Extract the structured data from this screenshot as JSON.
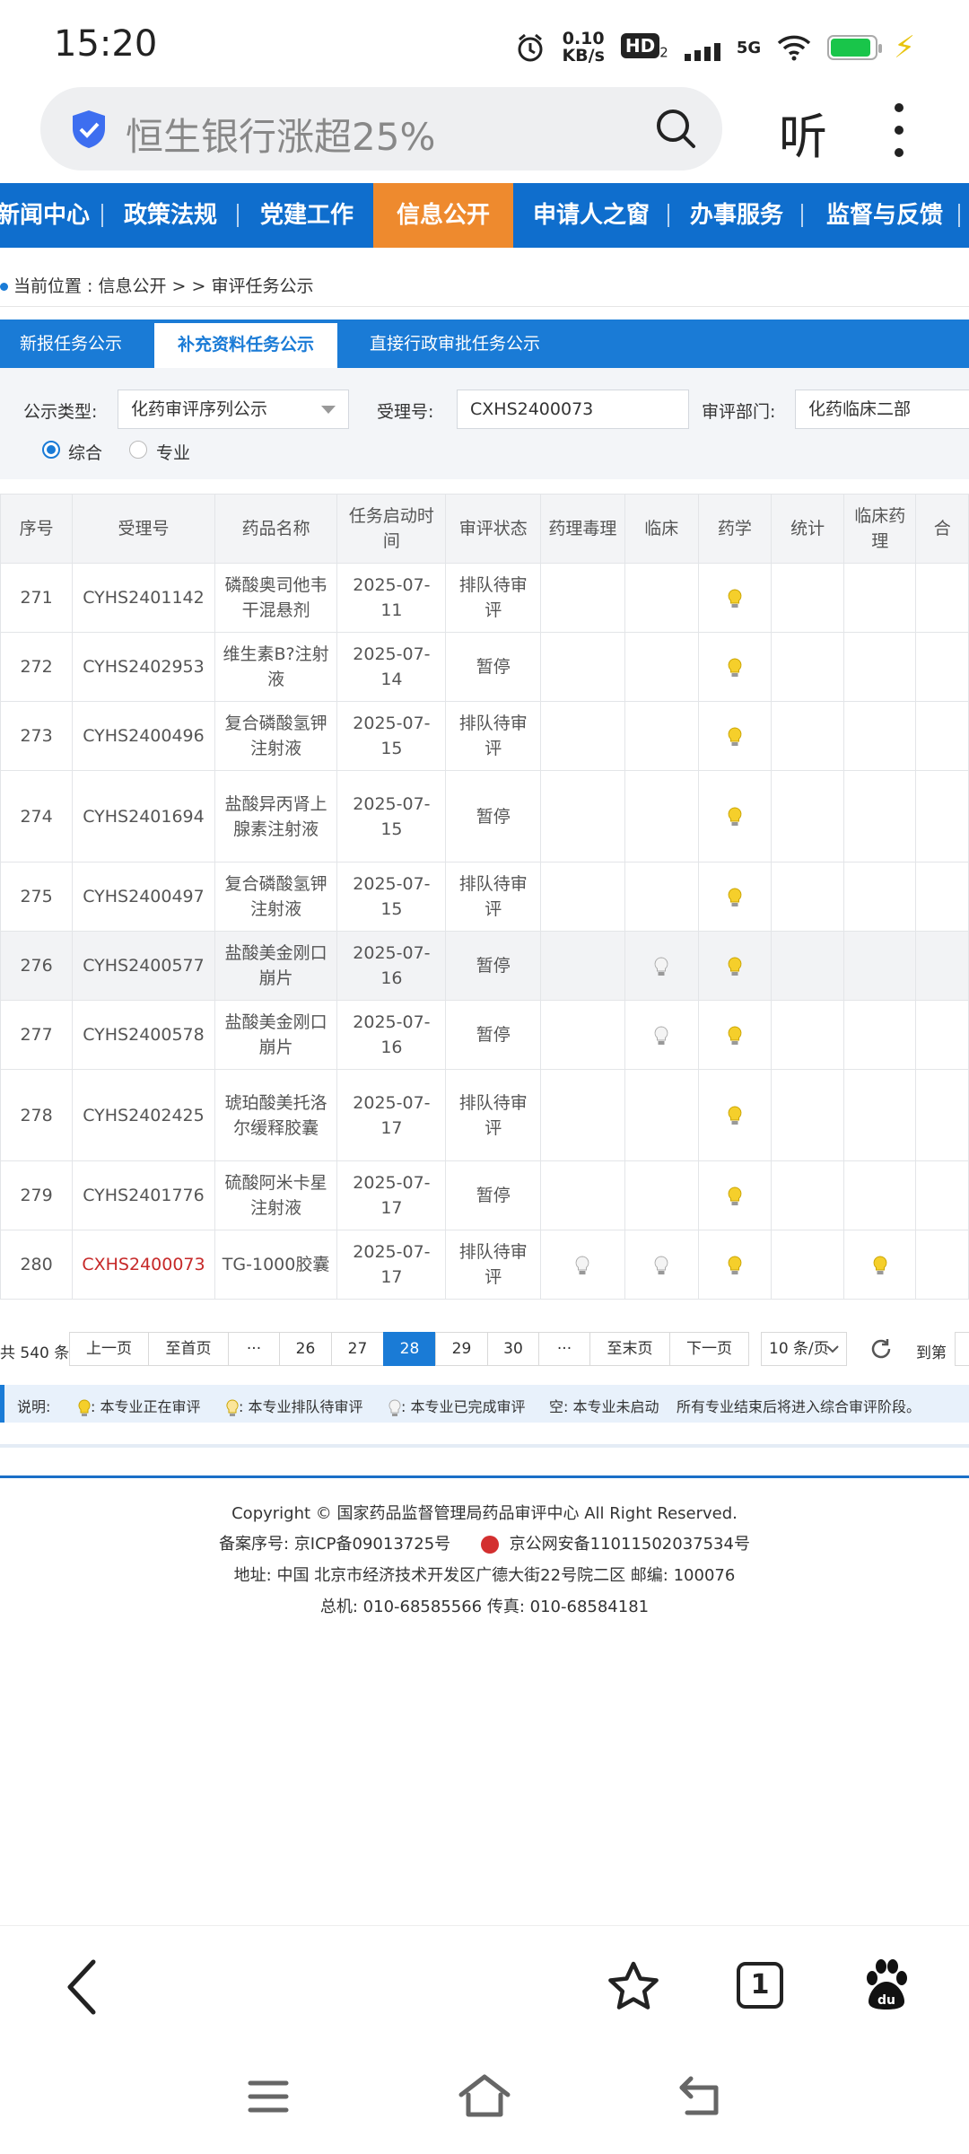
{
  "status": {
    "time": "15:20",
    "speed_value": "0.10",
    "speed_unit": "KB/s",
    "hd": "HD",
    "hd_sub": "2",
    "network": "5G"
  },
  "browser": {
    "search_query": "恒生银行涨超25%",
    "listen_label": "听"
  },
  "nav": {
    "items": [
      "新闻中心",
      "政策法规",
      "党建工作",
      "信息公开",
      "申请人之窗",
      "办事服务",
      "监督与反馈"
    ],
    "active": "信息公开"
  },
  "breadcrumb": "当前位置 : 信息公开 > > 审评任务公示",
  "tabs": [
    "新报任务公示",
    "补充资料任务公示",
    "直接行政审批任务公示"
  ],
  "filter": {
    "type_label": "公示类型:",
    "type_value": "化药审评序列公示",
    "accept_label": "受理号:",
    "accept_value": "CXHS2400073",
    "dept_label": "审评部门:",
    "dept_value": "化药临床二部",
    "radio_all": "综合",
    "radio_spec": "专业"
  },
  "table": {
    "headers": [
      "序号",
      "受理号",
      "药品名称",
      "任务启动时间",
      "审评状态",
      "药理毒理",
      "临床",
      "药学",
      "统计",
      "临床药理",
      "合"
    ],
    "rows": [
      {
        "no": "271",
        "code": "CYHS2401142",
        "name": "磷酸奥司他韦干混悬剂",
        "date": "2025-07-11",
        "status": "排队待审评",
        "bulbs": {
          "pharmacy": "on"
        }
      },
      {
        "no": "272",
        "code": "CYHS2402953",
        "name": "维生素B?注射液",
        "date": "2025-07-14",
        "status": "暂停",
        "bulbs": {
          "pharmacy": "on"
        }
      },
      {
        "no": "273",
        "code": "CYHS2400496",
        "name": "复合磷酸氢钾注射液",
        "date": "2025-07-15",
        "status": "排队待审评",
        "bulbs": {
          "pharmacy": "on"
        }
      },
      {
        "no": "274",
        "code": "CYHS2401694",
        "name": "盐酸异丙肾上腺素注射液",
        "date": "2025-07-15",
        "status": "暂停",
        "bulbs": {
          "pharmacy": "on"
        }
      },
      {
        "no": "275",
        "code": "CYHS2400497",
        "name": "复合磷酸氢钾注射液",
        "date": "2025-07-15",
        "status": "排队待审评",
        "bulbs": {
          "pharmacy": "on"
        }
      },
      {
        "no": "276",
        "code": "CYHS2400577",
        "name": "盐酸美金刚口崩片",
        "date": "2025-07-16",
        "status": "暂停",
        "bulbs": {
          "clinical": "done",
          "pharmacy": "on"
        }
      },
      {
        "no": "277",
        "code": "CYHS2400578",
        "name": "盐酸美金刚口崩片",
        "date": "2025-07-16",
        "status": "暂停",
        "bulbs": {
          "clinical": "done",
          "pharmacy": "on"
        }
      },
      {
        "no": "278",
        "code": "CYHS2402425",
        "name": "琥珀酸美托洛尔缓释胶囊",
        "date": "2025-07-17",
        "status": "排队待审评",
        "bulbs": {
          "pharmacy": "on"
        }
      },
      {
        "no": "279",
        "code": "CYHS2401776",
        "name": "硫酸阿米卡星注射液",
        "date": "2025-07-17",
        "status": "暂停",
        "bulbs": {
          "pharmacy": "on"
        }
      },
      {
        "no": "280",
        "code": "CXHS2400073",
        "name": "TG-1000胶囊",
        "date": "2025-07-17",
        "status": "排队待审评",
        "bulbs": {
          "tox": "done",
          "clinical": "done",
          "pharmacy": "on",
          "clinpharm": "on"
        }
      }
    ]
  },
  "pager": {
    "total": "共 540 条",
    "prev": "上一页",
    "first": "至首页",
    "ellipsis": "···",
    "pages": [
      "26",
      "27",
      "28",
      "29",
      "30"
    ],
    "current": "28",
    "last": "至末页",
    "next": "下一页",
    "per_page": "10 条/页",
    "goto": "到第"
  },
  "legend": {
    "title": "说明:",
    "on": ": 本专业正在审评",
    "queue": ": 本专业排队待审评",
    "done": ": 本专业已完成审评",
    "empty": "空: 本专业未启动",
    "note": "所有专业结束后将进入综合审评阶段。"
  },
  "footer": {
    "copyright": "Copyright © 国家药品监督管理局药品审评中心   All Right Reserved.",
    "icp": "备案序号: 京ICP备09013725号",
    "police": "京公网安备11011502037534号",
    "address": "地址: 中国 北京市经济技术开发区广德大街22号院二区      邮编: 100076",
    "phone": "总机: 010-68585566      传真: 010-68584181"
  },
  "bottom_bar": {
    "tab_count": "1"
  },
  "colors": {
    "nav_blue": "#0f6ecd",
    "nav_active": "#ee8a2e",
    "link_red": "#c62828"
  }
}
